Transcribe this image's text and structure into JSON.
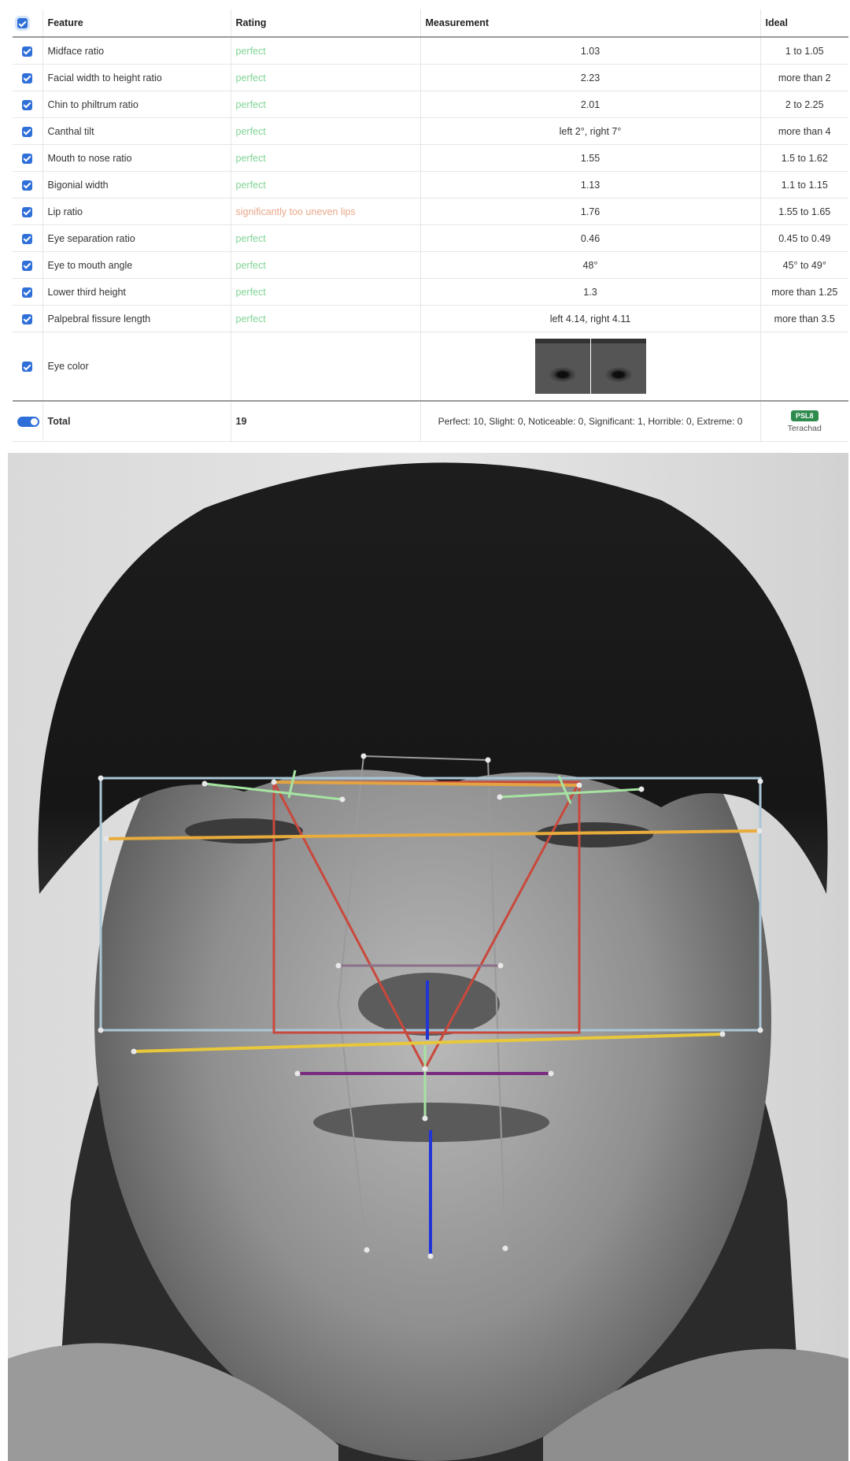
{
  "table": {
    "headers": {
      "feature": "Feature",
      "rating": "Rating",
      "measurement": "Measurement",
      "ideal": "Ideal"
    },
    "rows": [
      {
        "feature": "Midface ratio",
        "rating": "perfect",
        "measurement": "1.03",
        "ideal": "1 to 1.05"
      },
      {
        "feature": "Facial width to height ratio",
        "rating": "perfect",
        "measurement": "2.23",
        "ideal": "more than 2"
      },
      {
        "feature": "Chin to philtrum ratio",
        "rating": "perfect",
        "measurement": "2.01",
        "ideal": "2 to 2.25"
      },
      {
        "feature": "Canthal tilt",
        "rating": "perfect",
        "measurement": "left 2°, right 7°",
        "ideal": "more than 4"
      },
      {
        "feature": "Mouth to nose ratio",
        "rating": "perfect",
        "measurement": "1.55",
        "ideal": "1.5 to 1.62"
      },
      {
        "feature": "Bigonial width",
        "rating": "perfect",
        "measurement": "1.13",
        "ideal": "1.1 to 1.15"
      },
      {
        "feature": "Lip ratio",
        "rating": "significantly too uneven lips",
        "measurement": "1.76",
        "ideal": "1.55 to 1.65"
      },
      {
        "feature": "Eye separation ratio",
        "rating": "perfect",
        "measurement": "0.46",
        "ideal": "0.45 to 0.49"
      },
      {
        "feature": "Eye to mouth angle",
        "rating": "perfect",
        "measurement": "48°",
        "ideal": "45° to 49°"
      },
      {
        "feature": "Lower third height",
        "rating": "perfect",
        "measurement": "1.3",
        "ideal": "more than 1.25"
      },
      {
        "feature": "Palpebral fissure length",
        "rating": "perfect",
        "measurement": "left 4.14, right 4.11",
        "ideal": "more than 3.5"
      }
    ],
    "eye_color": {
      "feature": "Eye color"
    },
    "total": {
      "label": "Total",
      "score": "19",
      "summary": "Perfect: 10, Slight: 0, Noticeable: 0, Significant: 1, Horrible: 0, Extreme: 0",
      "badge": "PSL8",
      "tier": "Terachad"
    }
  },
  "colors": {
    "rating_perfect": "#7fd494",
    "rating_significant": "#e9a889",
    "checkbox": "#2f6fd8",
    "badge": "#2e8b4e"
  }
}
